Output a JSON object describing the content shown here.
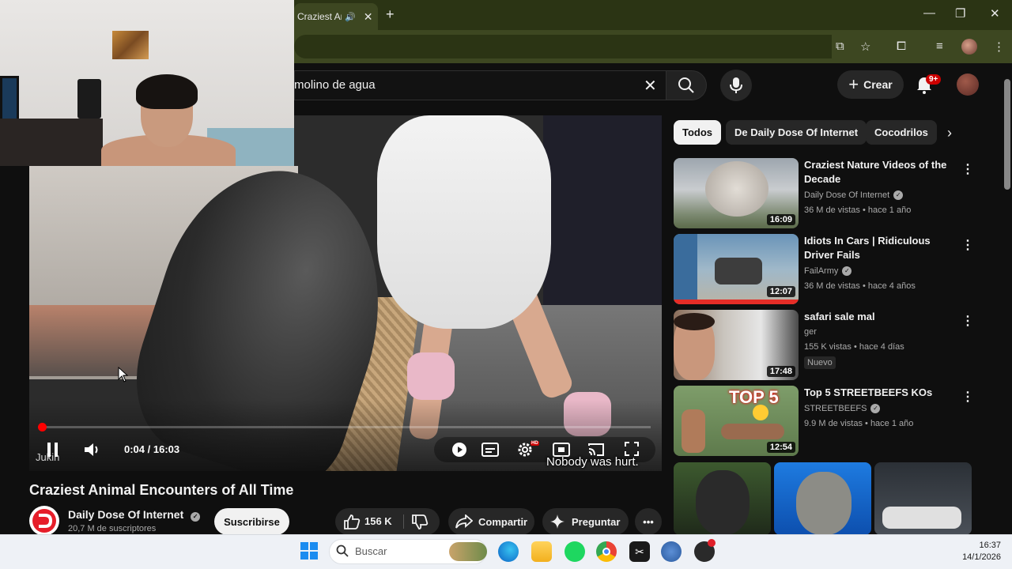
{
  "browser": {
    "tab_title": "Craziest Animal Encou",
    "new_tab_symbol": "+",
    "window_controls": [
      "—",
      "❐",
      "✕"
    ]
  },
  "youtube": {
    "search_query": "molino de agua",
    "create_label": "Crear",
    "notification_badge": "9+",
    "chips": [
      "Todos",
      "De Daily Dose Of Internet",
      "Cocodrilos"
    ],
    "player": {
      "time": "0:04 / 16:03",
      "progress_fraction": 0.004,
      "watermark": "Jukin",
      "caption": "Nobody was hurt.",
      "hd_label": "HD"
    },
    "video": {
      "title": "Craziest Animal Encounters of All Time",
      "channel": "Daily Dose Of Internet",
      "subscribers": "20,7 M de suscriptores",
      "subscribe_label": "Suscribirse",
      "likes": "156 K",
      "share_label": "Compartir",
      "ask_label": "Preguntar"
    },
    "recommendations": [
      {
        "title": "Craziest Nature Videos of the Decade",
        "channel": "Daily Dose Of Internet",
        "verified": true,
        "meta": "36 M de vistas • hace 1 año",
        "duration": "16:09",
        "badge": ""
      },
      {
        "title": "Idiots In Cars | Ridiculous Driver Fails",
        "channel": "FailArmy",
        "verified": true,
        "meta": "36 M de vistas • hace 4 años",
        "duration": "12:07",
        "badge": ""
      },
      {
        "title": "safari sale mal",
        "channel": "ger",
        "verified": false,
        "meta": "155 K vistas • hace 4 días",
        "duration": "17:48",
        "badge": "Nuevo"
      },
      {
        "title": "Top 5 STREETBEEFS KOs",
        "channel": "STREETBEEFS",
        "verified": true,
        "meta": "9.9 M de vistas • hace 1 año",
        "duration": "12:54",
        "badge": ""
      }
    ],
    "thumb_overlay_text": "TOP 5"
  },
  "taskbar": {
    "search_placeholder": "Buscar",
    "time": "16:37",
    "date": "14/1/2026"
  },
  "colors": {
    "browser_frame": "#2b3414",
    "browser_toolbar": "#3d4721",
    "youtube_bg": "#0f0f0f",
    "youtube_red": "#ff0000",
    "taskbar_bg": "#eef1f6"
  }
}
